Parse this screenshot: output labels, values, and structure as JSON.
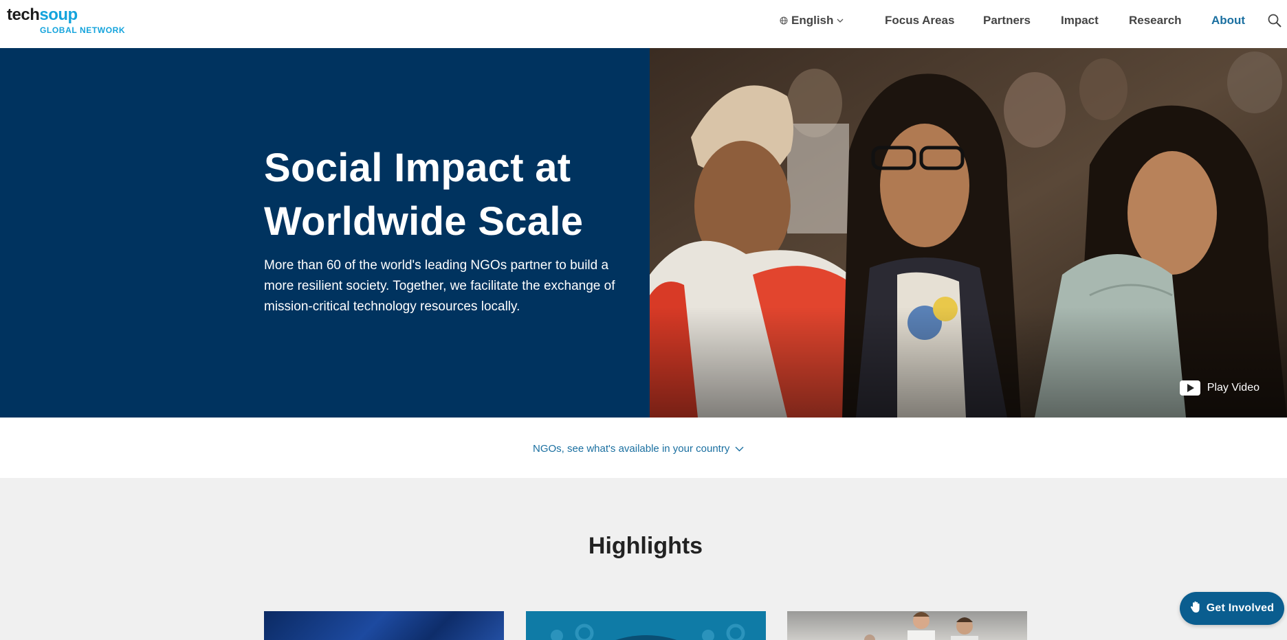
{
  "header": {
    "logo": {
      "part1": "tech",
      "part2": "soup",
      "subtitle": "GLOBAL NETWORK"
    },
    "language": {
      "label": "English",
      "icon": "globe-icon",
      "chevron": "chevron-down-icon"
    },
    "nav": [
      {
        "label": "Focus Areas"
      },
      {
        "label": "Partners"
      },
      {
        "label": "Impact"
      },
      {
        "label": "Research"
      },
      {
        "label": "About"
      }
    ],
    "active_nav": "About",
    "search_icon": "search-icon"
  },
  "hero": {
    "title": "Social Impact at Worldwide Scale",
    "description": "More than 60 of the world's leading NGOs partner to build a more resilient society. Together, we facilitate the exchange of mission-critical technology resources locally.",
    "play_video": {
      "label": "Play Video",
      "icon": "play-icon"
    }
  },
  "country_bar": {
    "link_text": "NGOs, see what's available in your country",
    "icon": "chevron-down-icon"
  },
  "highlights": {
    "title": "Highlights"
  },
  "get_involved": {
    "label": "Get Involved",
    "icon": "hand-icon"
  },
  "colors": {
    "hero_navy": "#00335f",
    "accent_blue": "#1a6fa0",
    "logo_blue": "#13a3dc",
    "button_blue": "#0a5d8f",
    "section_gray": "#f0f0f0"
  }
}
